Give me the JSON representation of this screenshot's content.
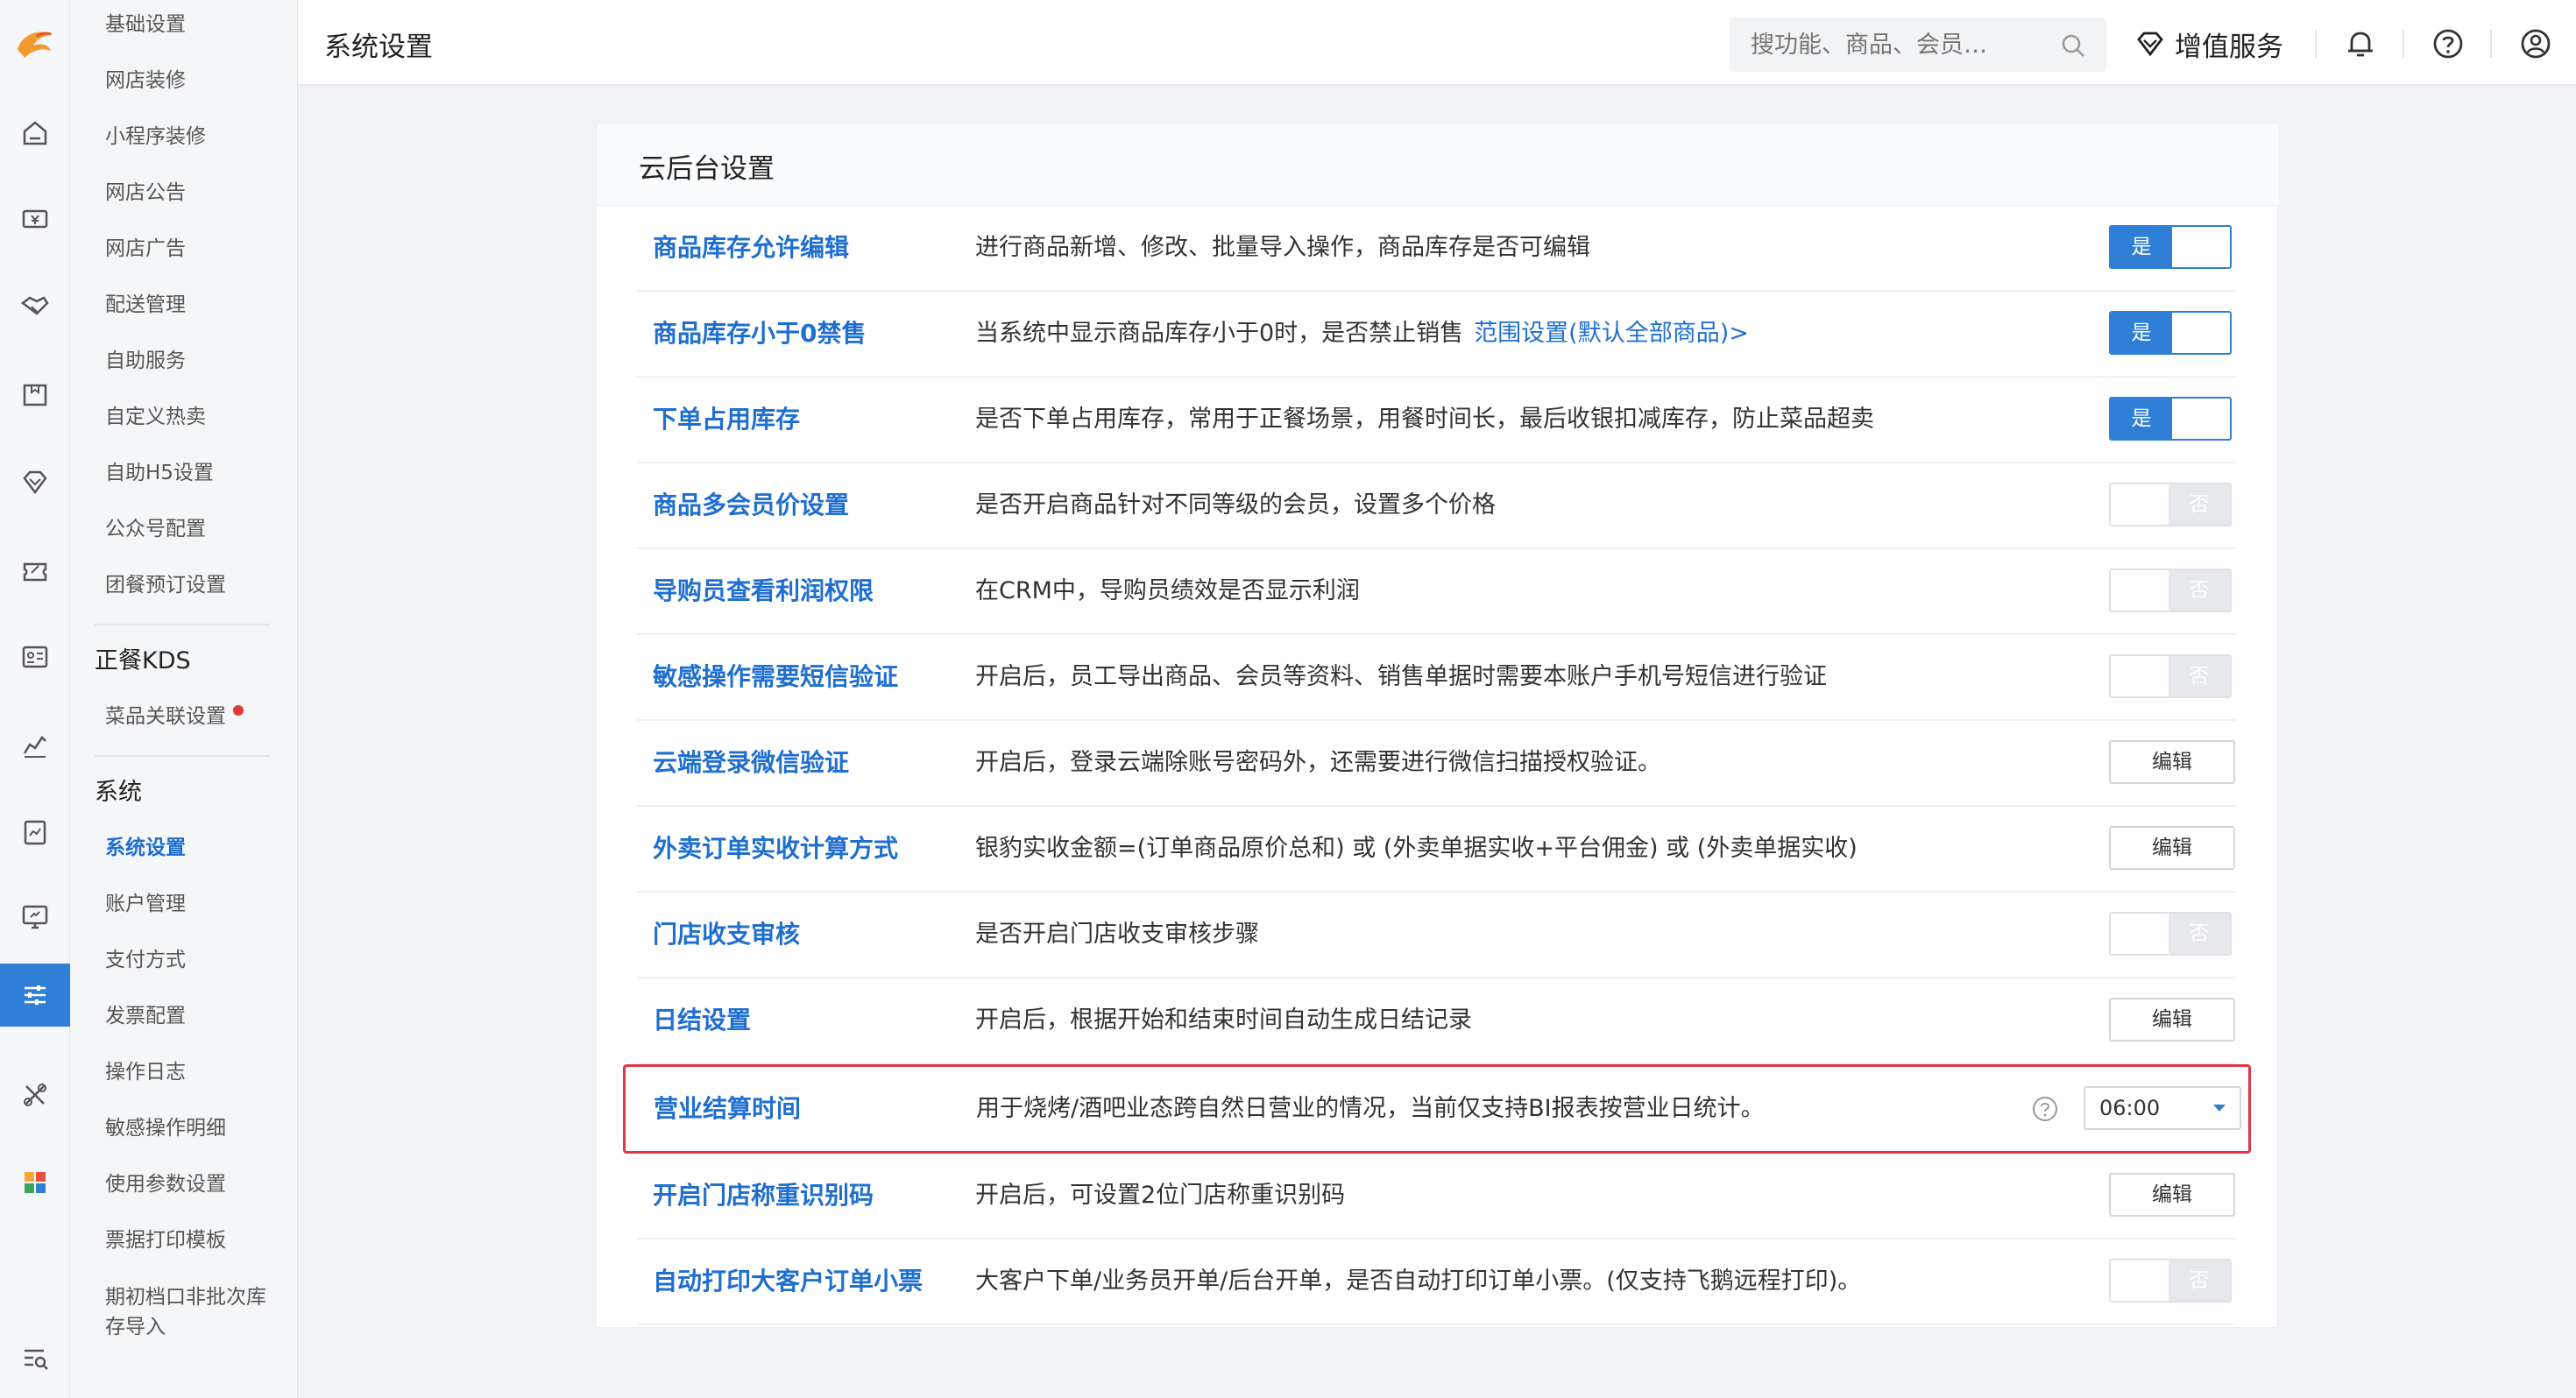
{
  "topbar": {
    "title": "系统设置",
    "search_placeholder": "搜功能、商品、会员…",
    "value_added_services": "增值服务"
  },
  "menu": {
    "items_top": [
      "基础设置",
      "网店装修",
      "小程序装修",
      "网店公告",
      "网店广告",
      "配送管理",
      "自助服务",
      "自定义热卖",
      "自助H5设置",
      "公众号配置",
      "团餐预订设置"
    ],
    "kds_header": "正餐KDS",
    "kds_item": "菜品关联设置",
    "system_header": "系统",
    "system_items": [
      "系统设置",
      "账户管理",
      "支付方式",
      "发票配置",
      "操作日志",
      "敏感操作明细",
      "使用参数设置",
      "票据打印模板",
      "期初档口非批次库存导入"
    ],
    "active_item": "系统设置"
  },
  "panel": {
    "title": "云后台设置",
    "yes_label": "是",
    "no_label": "否",
    "edit_label": "编辑",
    "rows": [
      {
        "title": "商品库存允许编辑",
        "desc": "进行商品新增、修改、批量导入操作，商品库存是否可编辑",
        "control": "toggle",
        "state": "on"
      },
      {
        "title": "商品库存小于0禁售",
        "desc": "当系统中显示商品库存小于0时，是否禁止销售",
        "link": "范围设置(默认全部商品)>",
        "control": "toggle",
        "state": "on"
      },
      {
        "title": "下单占用库存",
        "desc": "是否下单占用库存，常用于正餐场景，用餐时间长，最后收银扣减库存，防止菜品超卖",
        "control": "toggle",
        "state": "on"
      },
      {
        "title": "商品多会员价设置",
        "desc": "是否开启商品针对不同等级的会员，设置多个价格",
        "control": "toggle",
        "state": "off"
      },
      {
        "title": "导购员查看利润权限",
        "desc": "在CRM中，导购员绩效是否显示利润",
        "control": "toggle",
        "state": "off"
      },
      {
        "title": "敏感操作需要短信验证",
        "desc": "开启后，员工导出商品、会员等资料、销售单据时需要本账户手机号短信进行验证",
        "control": "toggle",
        "state": "off"
      },
      {
        "title": "云端登录微信验证",
        "desc": "开启后，登录云端除账号密码外，还需要进行微信扫描授权验证。",
        "control": "edit"
      },
      {
        "title": "外卖订单实收计算方式",
        "desc": "银豹实收金额=(订单商品原价总和) 或 (外卖单据实收+平台佣金) 或 (外卖单据实收)",
        "control": "edit"
      },
      {
        "title": "门店收支审核",
        "desc": "是否开启门店收支审核步骤",
        "control": "toggle",
        "state": "off"
      },
      {
        "title": "日结设置",
        "desc": "开启后，根据开始和结束时间自动生成日结记录",
        "control": "edit"
      },
      {
        "title": "营业结算时间",
        "desc": "用于烧烤/酒吧业态跨自然日营业的情况，当前仅支持BI报表按营业日统计。",
        "control": "select",
        "value": "06:00"
      },
      {
        "title": "开启门店称重识别码",
        "desc": "开启后，可设置2位门店称重识别码",
        "control": "edit"
      },
      {
        "title": "自动打印大客户订单小票",
        "desc": "大客户下单/业务员开单/后台开单，是否自动打印订单小票。(仅支持飞鹅远程打印)。",
        "control": "toggle",
        "state": "off"
      }
    ]
  },
  "colors": {
    "accent": "#2f7fd6",
    "link": "#1f6fd0",
    "highlight_border": "#e0364b"
  }
}
